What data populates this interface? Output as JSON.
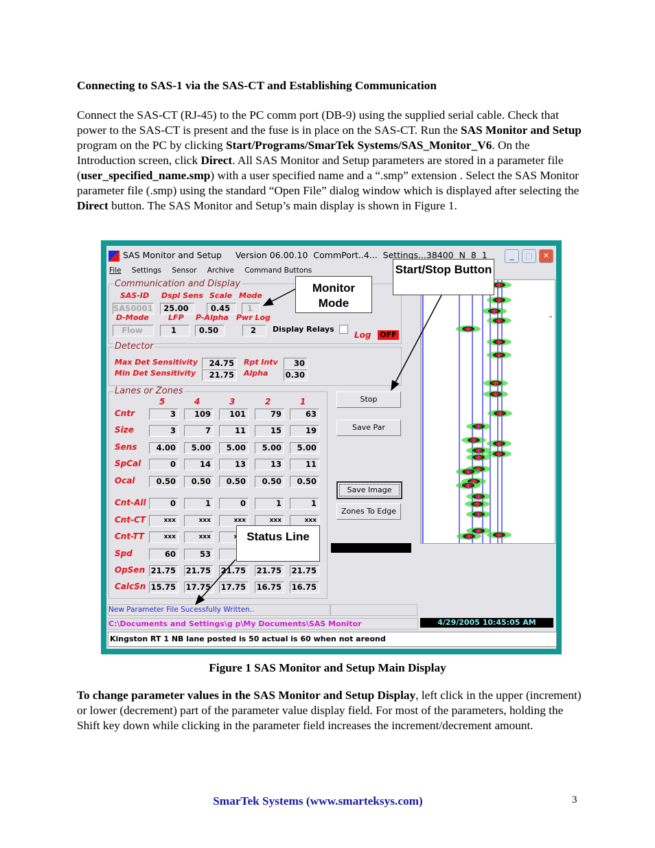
{
  "heading": "Connecting to SAS-1 via the SAS-CT and Establishing Communication",
  "para1": [
    {
      "t": "Connect the SAS-CT (RJ-45) to the PC comm port (DB-9) using the supplied serial cable. Check that power to the SAS-CT is present and the fuse is in place on the SAS-CT.  Run the "
    },
    {
      "t": "SAS Monitor and Setup",
      "b": true
    },
    {
      "t": " program on the PC by clicking "
    },
    {
      "t": "Start/Programs/SmarTek Systems/SAS_Monitor_V6",
      "b": true
    },
    {
      "t": ".  On the Introduction screen, click "
    },
    {
      "t": "Direct",
      "b": true
    },
    {
      "t": ".  All SAS Monitor and Setup parameters are stored in a parameter file ("
    },
    {
      "t": "user_specified_name.smp",
      "b": true
    },
    {
      "t": ") with a user specified name and a “.smp” extension .  Select the SAS Monitor parameter file (.smp) using the standard “Open File” dialog window which is displayed after selecting the "
    },
    {
      "t": "Direct",
      "b": true
    },
    {
      "t": " button. The SAS Monitor and Setup’s main display is shown in Figure 1."
    }
  ],
  "para2": [
    {
      "t": "To change parameter values in the SAS Monitor and Setup Display",
      "b": true
    },
    {
      "t": ", left click in the upper (increment) or lower (decrement) part of the parameter value display field.  For most of the parameters, holding the Shift key down while clicking in the parameter field increases the increment/decrement amount."
    }
  ],
  "caption": "Figure 1 SAS Monitor and Setup Main Display",
  "footer": "SmarTek Systems (www.smarteksys.com)",
  "page_number": "3",
  "app": {
    "title": "SAS Monitor and Setup     Version 06.00.10  CommPort..4...  Settings...38400  N  8  1",
    "menu": [
      "File",
      "Settings",
      "Sensor",
      "Archive",
      "Command Buttons"
    ],
    "comm": {
      "group": "Communication and Display",
      "labels": [
        "SAS-ID",
        "Dspl Sens",
        "Scale",
        "Mode",
        "D-Mode",
        "LFP",
        "P-Alpha",
        "Pwr Log"
      ],
      "sas_id": "SAS0001",
      "dspl_sens": "25.00",
      "scale": "0.45",
      "mode": "1",
      "d_mode": "Flow",
      "lfp": "1",
      "p_alpha": "0.50",
      "pwr_log": "2",
      "display_relays": "Display Relays",
      "display_relays_checked": false,
      "log_label": "Log",
      "log_state": "OFF"
    },
    "detector": {
      "group": "Detector",
      "max_label": "Max Det Sensitivity",
      "max": "24.75",
      "min_label": "Min Det Sensitivity",
      "min": "21.75",
      "rpt_label": "Rpt Intv",
      "rpt": "30",
      "alpha_label": "Alpha",
      "alpha": "0.30"
    },
    "lanes": {
      "group": "Lanes or Zones",
      "headers": [
        "5",
        "4",
        "3",
        "2",
        "1"
      ],
      "rows": [
        {
          "label": "Cntr",
          "values": [
            "3",
            "109",
            "101",
            "79",
            "63"
          ]
        },
        {
          "label": "Size",
          "values": [
            "3",
            "7",
            "11",
            "15",
            "19"
          ]
        },
        {
          "label": "Sens",
          "values": [
            "4.00",
            "5.00",
            "5.00",
            "5.00",
            "5.00"
          ]
        },
        {
          "label": "SpCal",
          "values": [
            "0",
            "14",
            "13",
            "13",
            "11"
          ]
        },
        {
          "label": "Ocal",
          "values": [
            "0.50",
            "0.50",
            "0.50",
            "0.50",
            "0.50"
          ]
        },
        {
          "label": "Cnt-All",
          "values": [
            "0",
            "1",
            "0",
            "1",
            "1"
          ]
        },
        {
          "label": "Cnt-CT",
          "values": [
            "xxx",
            "xxx",
            "xxx",
            "xxx",
            "xxx"
          ]
        },
        {
          "label": "Cnt-TT",
          "values": [
            "xxx",
            "xxx",
            "xxx",
            "xxx",
            "xxx"
          ]
        },
        {
          "label": "Spd",
          "values": [
            "60",
            "53",
            "",
            "",
            ""
          ]
        },
        {
          "label": "OpSen",
          "values": [
            "21.75",
            "21.75",
            "21.75",
            "21.75",
            "21.75"
          ]
        },
        {
          "label": "CalcSn",
          "values": [
            "15.75",
            "17.75",
            "17.75",
            "16.75",
            "16.75"
          ]
        }
      ]
    },
    "buttons": {
      "stop": "Stop",
      "save_par": "Save Par",
      "save_image": "Save Image",
      "zones_to_edge": "Zones To Edge"
    },
    "status": "New Parameter File Sucessfully Written..",
    "path": "C:\\Documents and Settings\\g p\\My Documents\\SAS Monitor",
    "datetime": "4/29/2005 10:45:05 AM",
    "message": "Kingston RT 1 NB lane posted is 50 actual is 60 when not areond",
    "colors": {
      "frame": "#119a94",
      "label_red": "#e0141c",
      "path_magenta": "#d21ed2",
      "datetime_cyan": "#7fe8f0"
    }
  },
  "callouts": {
    "monitor_mode": "Monitor Mode",
    "start_stop": "Start/Stop Button",
    "status_line": "Status Line"
  }
}
